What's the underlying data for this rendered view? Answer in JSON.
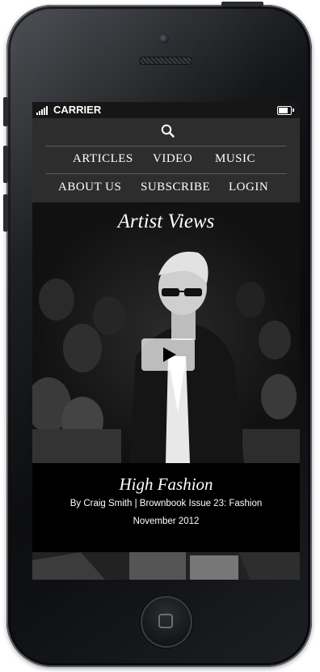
{
  "status_bar": {
    "carrier": "CARRIER",
    "battery_level": 0.8
  },
  "nav": {
    "row1": [
      "ARTICLES",
      "VIDEO",
      "MUSIC"
    ],
    "row2": [
      "ABOUT US",
      "SUBSCRIBE",
      "LOGIN"
    ]
  },
  "hero": {
    "section_title": "Artist Views"
  },
  "article": {
    "title": "High Fashion",
    "byline": "By Craig Smith | Brownbook Issue 23: Fashion",
    "date": "November 2012"
  },
  "colors": {
    "nav_bg": "#2d2d2d",
    "screen_bg": "#0b0b0b",
    "text": "#ffffff"
  },
  "icons": [
    "search-icon",
    "play-icon",
    "signal-icon",
    "battery-icon",
    "home-button-icon"
  ]
}
